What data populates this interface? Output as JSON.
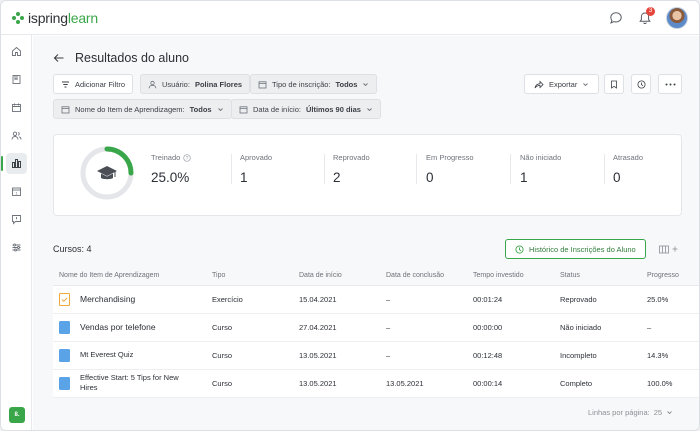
{
  "app": {
    "logo_prefix": "ispring",
    "logo_suffix": "learn",
    "notification_count": "3"
  },
  "sidebar": {
    "items": [
      "home-icon",
      "book-icon",
      "calendar-icon",
      "users-icon",
      "chart-icon",
      "calendar-day-icon",
      "chat-icon",
      "sliders-icon"
    ],
    "active_index": 4,
    "user_initial": "8."
  },
  "page": {
    "title": "Resultados do aluno"
  },
  "filters": {
    "add_filter": "Adicionar Filtro",
    "user_label": "Usuário:",
    "user_value": "Polina Flores",
    "enroll_label": "Tipo de inscrição:",
    "enroll_value": "Todos",
    "item_label": "Nome do Item de Aprendizagem:",
    "item_value": "Todos",
    "date_label": "Data de início:",
    "date_value": "Últimos 90 dias",
    "export": "Exportar"
  },
  "stats": {
    "trained_label": "Treinado",
    "trained_value": "25.0%",
    "trained_fraction": 0.25,
    "approved_label": "Aprovado",
    "approved_value": "1",
    "failed_label": "Reprovado",
    "failed_value": "2",
    "progress_label": "Em Progresso",
    "progress_value": "0",
    "notstarted_label": "Não iniciado",
    "notstarted_value": "1",
    "late_label": "Atrasado",
    "late_value": "0"
  },
  "courses": {
    "title": "Cursos: 4",
    "history_button": "Histórico de Inscrições do Aluno",
    "columns": [
      "Nome do Item de Aprendizagem",
      "Tipo",
      "Data de início",
      "Data de conclusão",
      "Tempo investido",
      "Status",
      "Progresso"
    ],
    "rows": [
      {
        "name": "Merchandising",
        "type": "Exercício",
        "start": "15.04.2021",
        "end": "–",
        "time": "00:01:24",
        "status": "Reprovado",
        "progress": "25.0%",
        "icon": "exercise-icon"
      },
      {
        "name": "Vendas por telefone",
        "type": "Curso",
        "start": "27.04.2021",
        "end": "–",
        "time": "00:00:00",
        "status": "Não iniciado",
        "progress": "–",
        "icon": "course-icon"
      },
      {
        "name": "Mt Everest Quiz",
        "type": "Curso",
        "start": "13.05.2021",
        "end": "–",
        "time": "00:12:48",
        "status": "Incompleto",
        "progress": "14.3%",
        "icon": "course-icon"
      },
      {
        "name": "Effective Start: 5 Tips for New Hires",
        "type": "Curso",
        "start": "13.05.2021",
        "end": "13.05.2021",
        "time": "00:00:14",
        "status": "Completo",
        "progress": "100.0%",
        "icon": "course-icon"
      }
    ],
    "rows_per_page_label": "Linhas por página:",
    "rows_per_page_value": "25"
  },
  "colors": {
    "brand": "#3aa64a",
    "badge": "#e5453a",
    "exercise": "#f2a83b",
    "course": "#5aa3e6"
  }
}
